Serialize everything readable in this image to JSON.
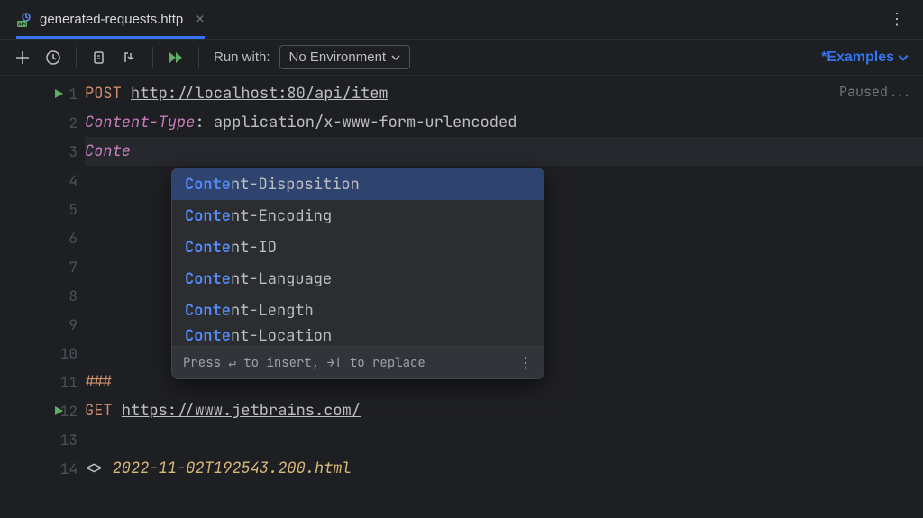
{
  "tab": {
    "filename": "generated-requests.http"
  },
  "toolbar": {
    "run_with_label": "Run with:",
    "environment": "No Environment",
    "examples_label": "*Examples"
  },
  "editor": {
    "paused_label": "Paused...",
    "lines": [
      {
        "num": "1",
        "run": true,
        "segments": [
          {
            "cls": "c-keyword",
            "t": "POST"
          },
          {
            "cls": "c-plain",
            "t": " "
          },
          {
            "cls": "c-url",
            "t": "http://localhost:80/api/item"
          }
        ]
      },
      {
        "num": "2",
        "segments": [
          {
            "cls": "c-header",
            "t": "Content-Type"
          },
          {
            "cls": "c-plain",
            "t": ": "
          },
          {
            "cls": "c-value",
            "t": "application/x-www-form-urlencoded"
          }
        ]
      },
      {
        "num": "3",
        "hl": true,
        "segments": [
          {
            "cls": "c-header",
            "t": "Conte"
          }
        ]
      },
      {
        "num": "4",
        "segments": []
      },
      {
        "num": "5",
        "segments": []
      },
      {
        "num": "6",
        "segments": []
      },
      {
        "num": "7",
        "segments": []
      },
      {
        "num": "8",
        "segments": []
      },
      {
        "num": "9",
        "segments": []
      },
      {
        "num": "10",
        "segments": []
      },
      {
        "num": "11",
        "segments": [
          {
            "cls": "c-sep",
            "t": "###"
          }
        ]
      },
      {
        "num": "12",
        "run": true,
        "segments": [
          {
            "cls": "c-keyword",
            "t": "GET"
          },
          {
            "cls": "c-plain",
            "t": " "
          },
          {
            "cls": "c-url",
            "t": "https://www.jetbrains.com/"
          }
        ]
      },
      {
        "num": "13",
        "segments": []
      },
      {
        "num": "14",
        "segments": [
          {
            "cls": "c-plain",
            "t": "<> "
          },
          {
            "cls": "c-file",
            "t": "2022-11-02T192543.200.html"
          }
        ]
      }
    ]
  },
  "completion": {
    "items": [
      {
        "match": "Conte",
        "rest": "nt-Disposition",
        "selected": true
      },
      {
        "match": "Conte",
        "rest": "nt-Encoding"
      },
      {
        "match": "Conte",
        "rest": "nt-ID"
      },
      {
        "match": "Conte",
        "rest": "nt-Language"
      },
      {
        "match": "Conte",
        "rest": "nt-Length"
      },
      {
        "match": "Conte",
        "rest": "nt-Location",
        "cut": true
      }
    ],
    "footer_hint": "Press ↵ to insert, →∣ to replace"
  }
}
